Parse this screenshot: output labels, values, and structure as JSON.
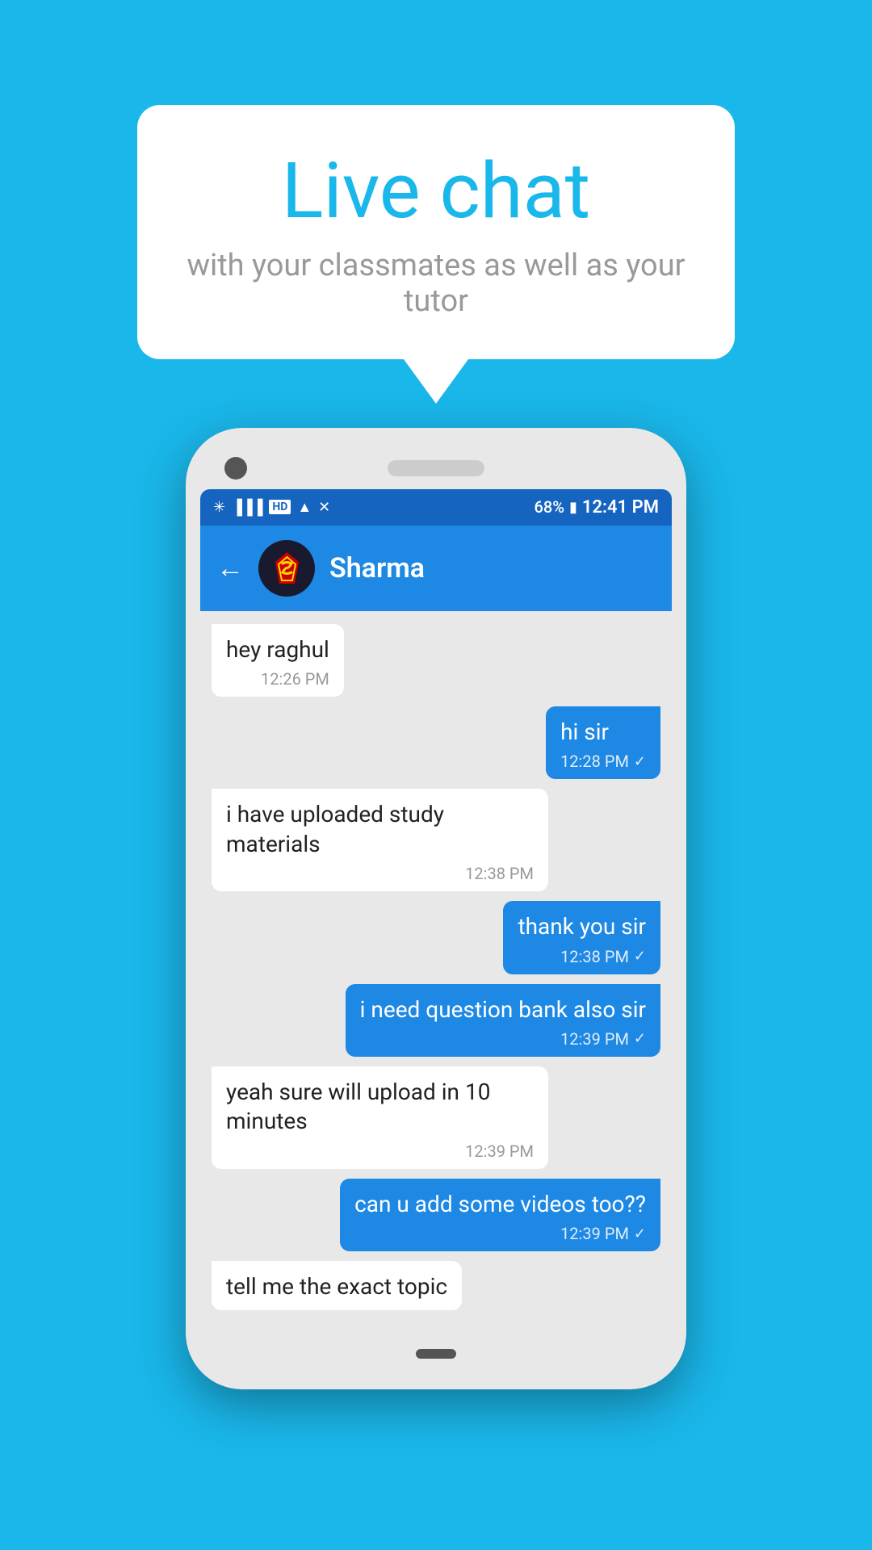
{
  "background_color": "#1AB7EA",
  "speech_bubble": {
    "title": "Live chat",
    "subtitle": "with your classmates as well as your tutor"
  },
  "phone": {
    "status_bar": {
      "time": "12:41 PM",
      "battery": "68%",
      "icons": "bluetooth wifi signal"
    },
    "app_header": {
      "contact_name": "Sharma",
      "back_label": "←"
    },
    "messages": [
      {
        "id": 1,
        "type": "received",
        "text": "hey raghul",
        "time": "12:26 PM",
        "check": false
      },
      {
        "id": 2,
        "type": "sent",
        "text": "hi sir",
        "time": "12:28 PM",
        "check": true
      },
      {
        "id": 3,
        "type": "received",
        "text": "i have uploaded study materials",
        "time": "12:38 PM",
        "check": false
      },
      {
        "id": 4,
        "type": "sent",
        "text": "thank you sir",
        "time": "12:38 PM",
        "check": true
      },
      {
        "id": 5,
        "type": "sent",
        "text": "i need question bank also sir",
        "time": "12:39 PM",
        "check": true
      },
      {
        "id": 6,
        "type": "received",
        "text": "yeah sure will upload in 10 minutes",
        "time": "12:39 PM",
        "check": false
      },
      {
        "id": 7,
        "type": "sent",
        "text": "can u add some videos too??",
        "time": "12:39 PM",
        "check": true
      },
      {
        "id": 8,
        "type": "received",
        "text": "tell me the exact topic",
        "time": "",
        "check": false,
        "partial": true
      }
    ]
  }
}
